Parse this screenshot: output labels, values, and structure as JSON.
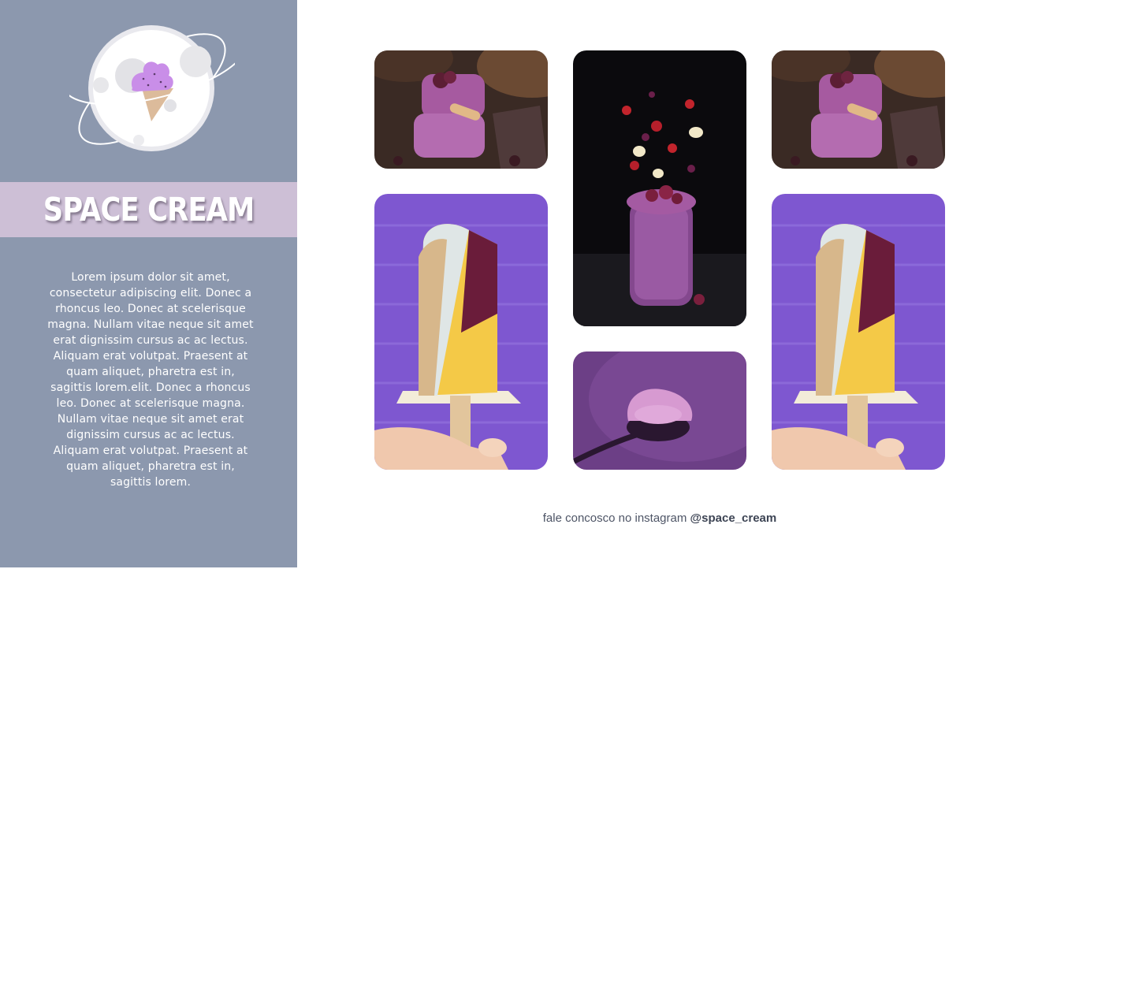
{
  "brand": {
    "name": "SPACE CREAM",
    "logo_icon": "ice-cream-planet-logo"
  },
  "sidebar": {
    "description": "Lorem ipsum dolor sit amet, consectetur adipiscing elit. Donec a rhoncus leo. Donec at scelerisque magna. Nullam vitae neque sit amet erat dignissim cursus ac ac lectus. Aliquam erat volutpat. Praesent at quam aliquet, pharetra est in, sagittis lorem.elit. Donec a rhoncus leo. Donec at scelerisque magna. Nullam vitae neque sit amet erat dignissim cursus ac ac lectus. Aliquam erat volutpat. Praesent at quam aliquet, pharetra est in, sagittis lorem."
  },
  "footer": {
    "text": "fale concosco no instagram",
    "handle": "@space_cream"
  },
  "colors": {
    "sidebar_bg": "#8c98ae",
    "title_band": "#cdbfd6",
    "accent_purple": "#8a5fd6"
  }
}
